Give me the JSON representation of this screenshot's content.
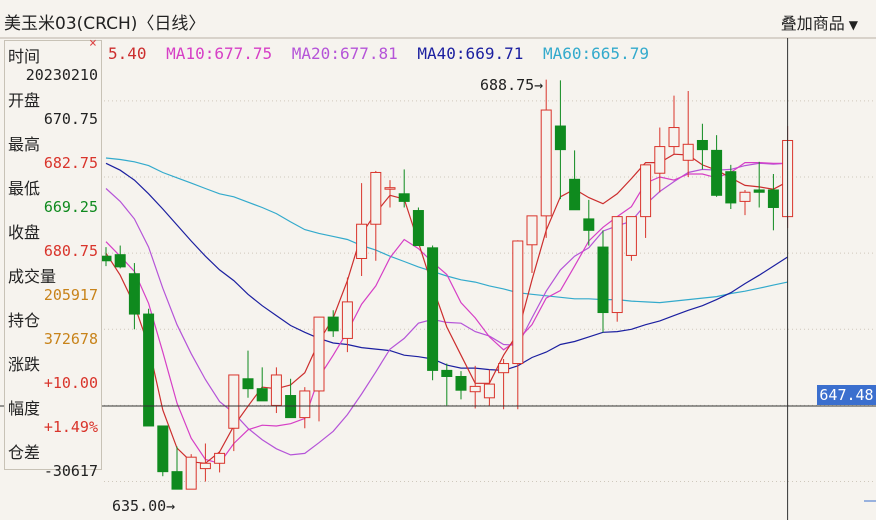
{
  "header": {
    "title": "美玉米03(CRCH)〈日线〉",
    "overlay_label": "叠加商品",
    "overlay_arrow": "▼"
  },
  "ma_legend": [
    {
      "label": "5.40",
      "color": "#cc2e2e"
    },
    {
      "label": "MA10:677.75",
      "color": "#d63fc6"
    },
    {
      "label": "MA20:677.81",
      "color": "#b554d8"
    },
    {
      "label": "MA40:669.71",
      "color": "#1b1fa0"
    },
    {
      "label": "MA60:665.79",
      "color": "#33aacc"
    }
  ],
  "info_panel": {
    "time_label": "时间",
    "time_value": "20230210",
    "open_label": "开盘",
    "open_value": "670.75",
    "high_label": "最高",
    "high_value": "682.75",
    "low_label": "最低",
    "low_value": "669.25",
    "close_label": "收盘",
    "close_value": "680.75",
    "volume_label": "成交量",
    "volume_value": "205917",
    "oi_label": "持仓",
    "oi_value": "372678",
    "change_label": "涨跌",
    "change_value": "+10.00",
    "pct_label": "幅度",
    "pct_value": "+1.49%",
    "oi_change_label": "仓差",
    "oi_change_value": "-30617",
    "close_icon": "×"
  },
  "annotations": {
    "high_marker": "688.75→",
    "low_marker": "635.00→",
    "crosshair_price": "647.48"
  },
  "colors": {
    "up": "#d9342b",
    "down": "#0f8a1e",
    "background": "#f6f3ee"
  },
  "chart_data": {
    "type": "candlestick",
    "ylim": [
      632,
      694
    ],
    "candles": [
      [
        665.6,
        666.8,
        664.3,
        665.0
      ],
      [
        665.8,
        667.0,
        664.0,
        664.2
      ],
      [
        663.3,
        664.7,
        656.0,
        658.0
      ],
      [
        658.0,
        658.7,
        643.3,
        643.3
      ],
      [
        643.3,
        643.3,
        636.7,
        637.3
      ],
      [
        637.3,
        640.6,
        635.0,
        635.0
      ],
      [
        635.0,
        639.6,
        635.0,
        639.2
      ],
      [
        637.7,
        641.0,
        636.0,
        638.4
      ],
      [
        638.4,
        640.0,
        637.2,
        639.7
      ],
      [
        643.0,
        650.0,
        640.0,
        650.0
      ],
      [
        649.5,
        653.2,
        647.0,
        648.2
      ],
      [
        648.2,
        651.0,
        647.0,
        646.6
      ],
      [
        646.0,
        651.0,
        645.0,
        650.0
      ],
      [
        647.3,
        649.5,
        646.0,
        644.4
      ],
      [
        644.4,
        648.4,
        643.0,
        647.9
      ],
      [
        647.9,
        657.6,
        643.9,
        657.6
      ],
      [
        657.6,
        658.5,
        655.0,
        655.8
      ],
      [
        654.8,
        662.8,
        653.0,
        659.6
      ],
      [
        665.3,
        675.2,
        663.0,
        669.8
      ],
      [
        669.8,
        676.8,
        665.0,
        676.6
      ],
      [
        674.6,
        675.6,
        672.0,
        674.6
      ],
      [
        673.8,
        677.0,
        672.0,
        672.8
      ],
      [
        671.6,
        672.0,
        667.0,
        667.0
      ],
      [
        666.7,
        667.0,
        649.3,
        650.6
      ],
      [
        650.6,
        651.5,
        646.0,
        649.8
      ],
      [
        649.8,
        650.5,
        646.8,
        648.0
      ],
      [
        647.8,
        651.2,
        645.6,
        648.5
      ],
      [
        647.0,
        650.7,
        646.0,
        648.8
      ],
      [
        650.3,
        652.1,
        645.5,
        651.5
      ],
      [
        651.5,
        667.7,
        645.5,
        667.6
      ],
      [
        667.1,
        669.5,
        663.4,
        670.9
      ],
      [
        670.9,
        688.8,
        668.0,
        684.8
      ],
      [
        682.7,
        688.7,
        673.1,
        679.6
      ],
      [
        675.7,
        679.5,
        674.0,
        671.7
      ],
      [
        670.5,
        673.0,
        667.0,
        669.0
      ],
      [
        666.8,
        669.0,
        655.6,
        658.2
      ],
      [
        658.2,
        670.8,
        657.0,
        670.8
      ],
      [
        665.7,
        670.0,
        665.0,
        670.8
      ],
      [
        670.8,
        677.6,
        668.0,
        677.6
      ],
      [
        676.5,
        682.5,
        674.0,
        680.0
      ],
      [
        680.0,
        686.7,
        679.0,
        682.5
      ],
      [
        678.2,
        687.3,
        676.0,
        680.3
      ],
      [
        680.8,
        683.0,
        677.0,
        679.6
      ],
      [
        679.5,
        681.5,
        673.4,
        673.6
      ],
      [
        676.7,
        677.6,
        671.8,
        672.6
      ],
      [
        672.8,
        674.3,
        671.0,
        674.0
      ],
      [
        674.3,
        678.0,
        672.0,
        674.0
      ],
      [
        674.3,
        676.4,
        669.0,
        672.0
      ],
      [
        670.8,
        682.7,
        669.3,
        680.8
      ]
    ],
    "ma5": [
      666,
      663.1,
      659.2,
      653.8,
      645.4,
      640.4,
      638.6,
      638.4,
      639.9,
      643.3,
      645.9,
      648.4,
      648.2,
      648.7,
      650.3,
      654.4,
      657.5,
      662.4,
      668.5,
      671.3,
      673.6,
      673.1,
      667.4,
      661.6,
      656.3,
      652.6,
      648.9,
      648.9,
      652.6,
      655.5,
      662.5,
      669,
      673.4,
      674.4,
      673.3,
      672.5,
      673.8,
      675.8,
      677.9,
      677.9,
      679,
      678.9,
      677.6,
      676.9,
      675.9,
      674.9,
      674.7,
      674.4,
      675.4
    ],
    "ma10": [
      667.5,
      665.6,
      663.6,
      659.4,
      653,
      646.3,
      641.7,
      638.9,
      638.4,
      641,
      642.8,
      643.4,
      643.3,
      643.6,
      644.3,
      649.7,
      652.6,
      655.7,
      659.3,
      661.7,
      665.4,
      667.8,
      666.6,
      664.8,
      663.2,
      659.5,
      657.5,
      655,
      653.3,
      654.6,
      656.6,
      660.1,
      661.1,
      664.3,
      667.6,
      669.4,
      670.8,
      672.1,
      675.2,
      676,
      675.6,
      676.4,
      676.4,
      675.9,
      676.6,
      677.9,
      677.9,
      677.8,
      677.8
    ],
    "ma20": [
      674.5,
      672.8,
      670.5,
      666.8,
      661.4,
      656.6,
      652.8,
      649.4,
      646.5,
      645,
      643,
      641.5,
      640.3,
      639.5,
      639.7,
      641.1,
      642.6,
      644.8,
      647.5,
      650.4,
      653.4,
      654.8,
      656.8,
      657.3,
      656.9,
      656.8,
      655.7,
      655.1,
      654,
      653.9,
      657.5,
      661,
      663.8,
      665.6,
      666.7,
      668.9,
      669.6,
      670.2,
      672.4,
      674.1,
      675.4,
      676.6,
      677,
      676.9,
      677,
      677.5,
      677.8,
      677.7,
      677.8
    ],
    "ma40": [
      677.8,
      676.9,
      675.6,
      673.8,
      671.8,
      669.7,
      667.6,
      665.6,
      663.8,
      662.4,
      660.6,
      659.1,
      657.8,
      656.5,
      655.6,
      654.8,
      654.2,
      654,
      653.6,
      653.4,
      653.2,
      652.6,
      652.4,
      652.1,
      651.3,
      650.9,
      650.9,
      650.7,
      650.6,
      651.2,
      652.3,
      653,
      654,
      654.4,
      655,
      655.6,
      655.7,
      656,
      656.6,
      657.1,
      657.8,
      658.5,
      659.1,
      659.9,
      660.8,
      662,
      663.1,
      664.3,
      665.5
    ],
    "ma60": [
      678.5,
      678.3,
      678,
      677.5,
      676.6,
      675.9,
      675.2,
      674.5,
      673.8,
      673.4,
      672.7,
      672,
      671.2,
      670.1,
      669.1,
      668.6,
      668.2,
      667.8,
      667,
      666.4,
      665.6,
      664.9,
      664.2,
      663.6,
      663,
      662.5,
      662.2,
      661.7,
      661.3,
      660.8,
      660.6,
      660.4,
      660.2,
      660,
      660,
      659.9,
      659.9,
      659.7,
      659.6,
      659.5,
      659.7,
      659.9,
      660.1,
      660.3,
      660.7,
      661,
      661.4,
      661.8,
      662.2
    ]
  }
}
